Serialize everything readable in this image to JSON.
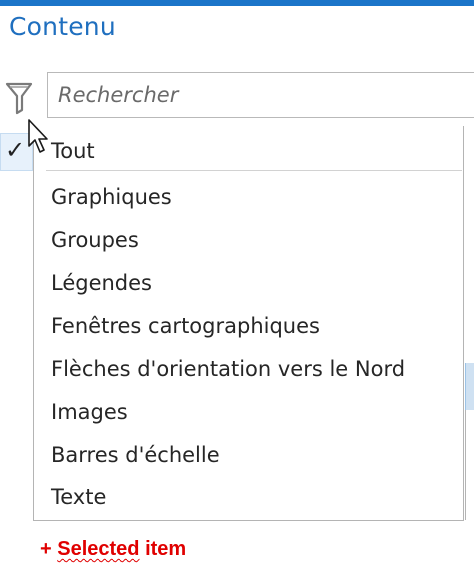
{
  "pane": {
    "title": "Contenu"
  },
  "search": {
    "placeholder": "Rechercher",
    "value": ""
  },
  "icons": {
    "filter": "filter-icon",
    "check": "checkmark-icon",
    "cursor": "mouse-pointer-icon"
  },
  "check_glyph": "✓",
  "filter_menu": {
    "items": [
      {
        "label": "Tout",
        "selected": true
      },
      {
        "label": "Graphiques",
        "selected": false
      },
      {
        "label": "Groupes",
        "selected": false
      },
      {
        "label": "Légendes",
        "selected": false
      },
      {
        "label": "Fenêtres cartographiques",
        "selected": false
      },
      {
        "label": "Flèches d'orientation vers le Nord",
        "selected": false
      },
      {
        "label": "Images",
        "selected": false
      },
      {
        "label": "Barres d'échelle",
        "selected": false
      },
      {
        "label": "Texte",
        "selected": false
      }
    ]
  },
  "annotation": {
    "prefix": "+ ",
    "word1": "Selected",
    "word2": " item"
  },
  "colors": {
    "accent": "#1b75c9",
    "title": "#1f6fbf",
    "annotation": "#e00000",
    "selection": "#e7f1fb"
  }
}
